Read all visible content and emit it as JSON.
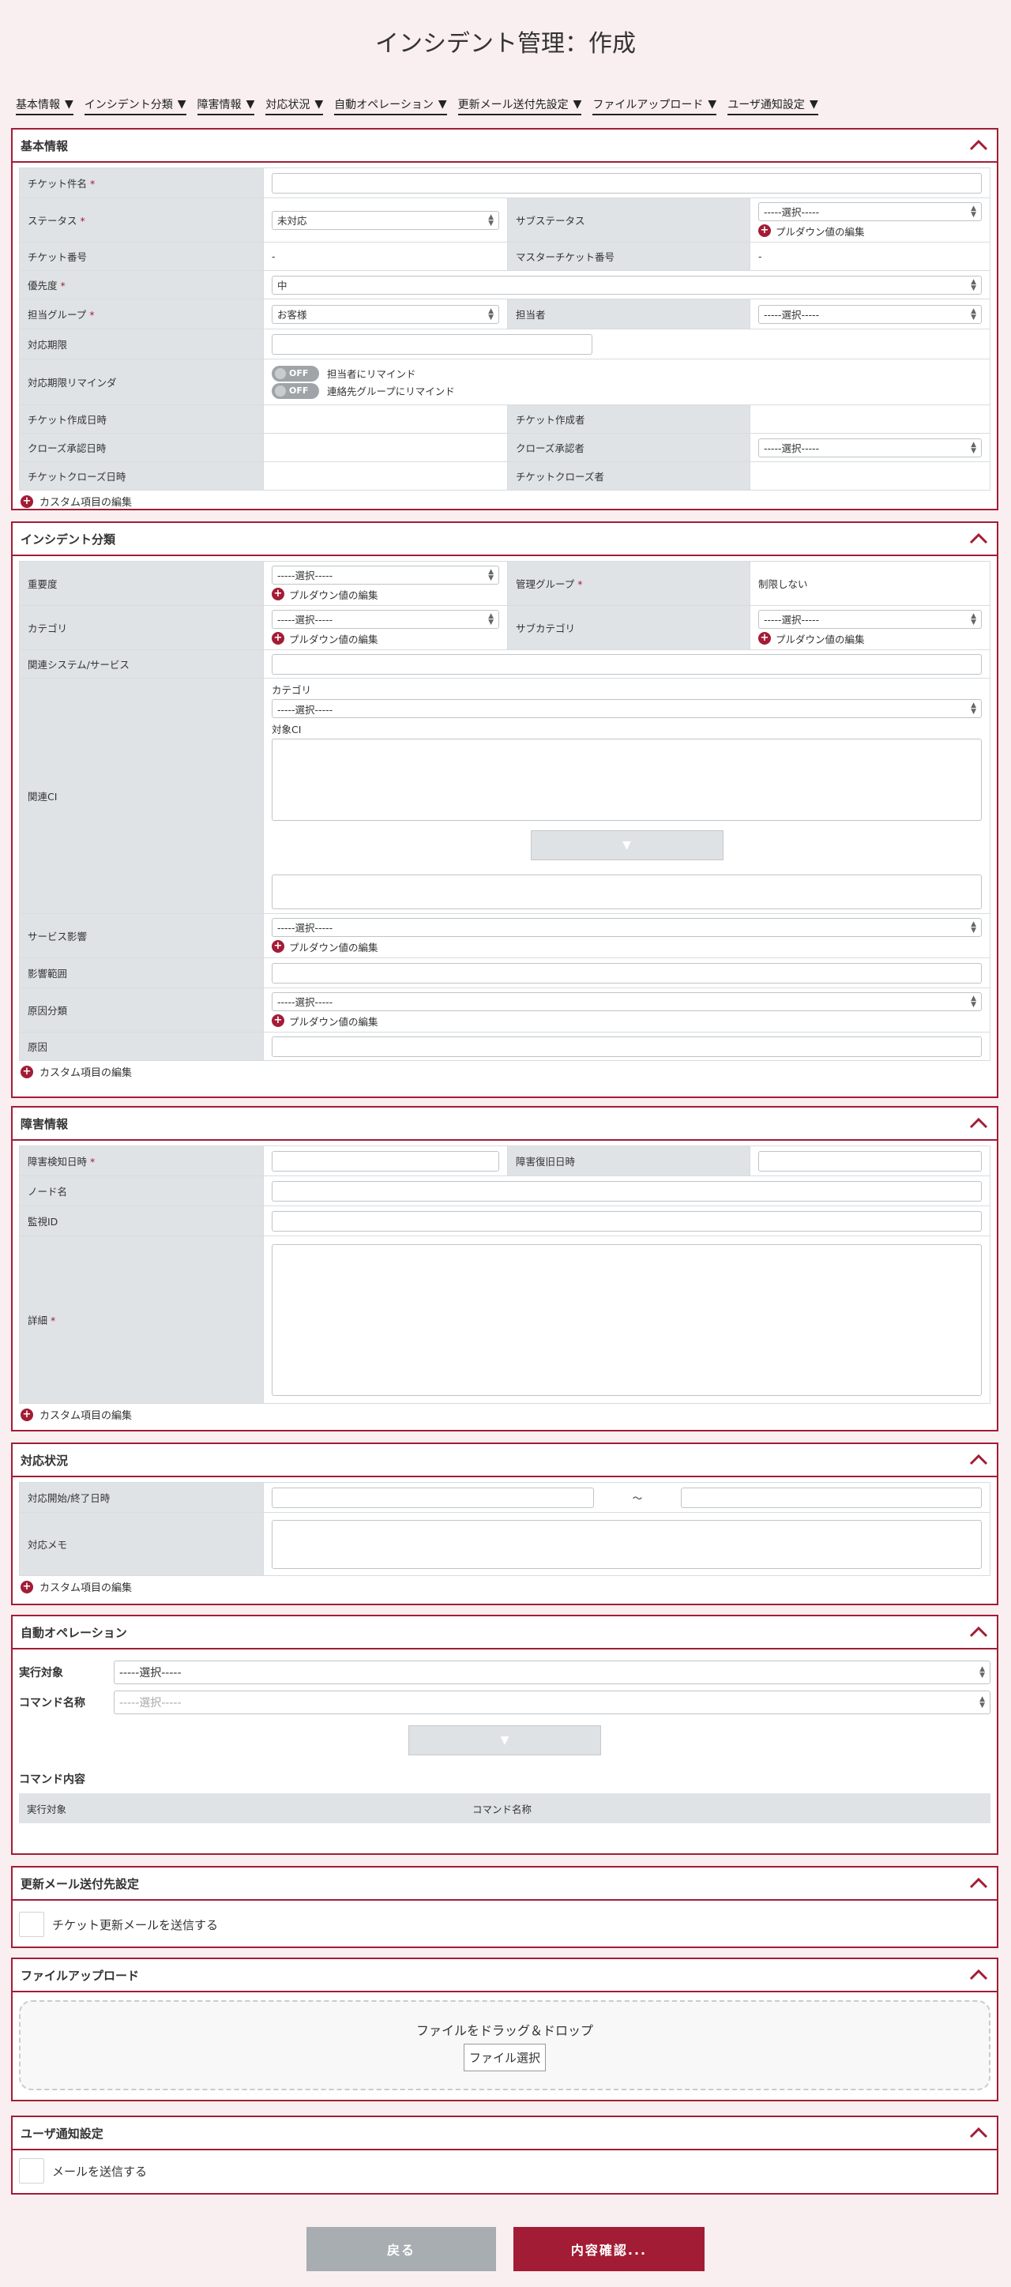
{
  "title": "インシデント管理：作成",
  "nav": [
    "基本情報",
    "インシデント分類",
    "障害情報",
    "対応状況",
    "自動オペレーション",
    "更新メール送付先設定",
    "ファイルアップロード",
    "ユーザ通知設定"
  ],
  "common": {
    "select_placeholder": "-----選択-----",
    "pulldown_edit": "プルダウン値の編集",
    "custom_edit": "カスタム項目の編集",
    "dash": "-",
    "tilde": "～"
  },
  "basic": {
    "heading": "基本情報",
    "ticket_name": "チケット件名",
    "status": "ステータス",
    "status_value": "未対応",
    "sub_status": "サブステータス",
    "ticket_no": "チケット番号",
    "master_ticket_no": "マスターチケット番号",
    "priority": "優先度",
    "priority_value": "中",
    "group": "担当グループ",
    "group_value": "お客様",
    "assignee": "担当者",
    "deadline": "対応期限",
    "reminder": "対応期限リマインダ",
    "off": "OFF",
    "remind_assignee": "担当者にリマインド",
    "remind_contact": "連絡先グループにリマインド",
    "created_at": "チケット作成日時",
    "created_by": "チケット作成者",
    "close_approve_at": "クローズ承認日時",
    "close_approver": "クローズ承認者",
    "closed_at": "チケットクローズ日時",
    "closed_by": "チケットクローズ者"
  },
  "classification": {
    "heading": "インシデント分類",
    "severity": "重要度",
    "mgmt_group": "管理グループ",
    "mgmt_group_value": "制限しない",
    "category": "カテゴリ",
    "sub_category": "サブカテゴリ",
    "related_system": "関連システム/サービス",
    "related_ci": "関連CI",
    "ci_category": "カテゴリ",
    "target_ci": "対象CI",
    "service_impact": "サービス影響",
    "impact_scope": "影響範囲",
    "cause_class": "原因分類",
    "cause": "原因"
  },
  "failure": {
    "heading": "障害情報",
    "detected_at": "障害検知日時",
    "recovered_at": "障害復旧日時",
    "node": "ノード名",
    "monitor_id": "監視ID",
    "detail": "詳細"
  },
  "response": {
    "heading": "対応状況",
    "period": "対応開始/終了日時",
    "memo": "対応メモ"
  },
  "auto_op": {
    "heading": "自動オペレーション",
    "target": "実行対象",
    "command": "コマンド名称",
    "content": "コマンド内容",
    "col_target": "実行対象",
    "col_command": "コマンド名称"
  },
  "mail": {
    "heading": "更新メール送付先設定",
    "send": "チケット更新メールを送信する"
  },
  "upload": {
    "heading": "ファイルアップロード",
    "drop": "ファイルをドラッグ＆ドロップ",
    "select": "ファイル選択"
  },
  "notify": {
    "heading": "ユーザ通知設定",
    "send": "メールを送信する"
  },
  "buttons": {
    "back": "戻る",
    "confirm": "内容確認..."
  },
  "colors": {
    "accent": "#a31c35",
    "back": "#a7adb0"
  }
}
